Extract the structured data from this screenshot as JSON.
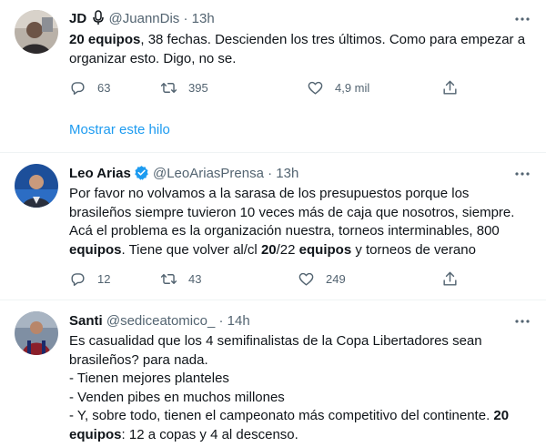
{
  "tweets": [
    {
      "name": "JD",
      "handle": "@JuannDis",
      "time": "13h",
      "text": [
        [
          {
            "b": "20 equipos"
          },
          {
            "t": ", 38 fechas. Descienden los tres últimos. Como para empezar a organizar esto. Digo, no se."
          }
        ]
      ],
      "replies": "63",
      "retweets": "395",
      "likes": "4,9 mil",
      "show_thread": "Mostrar este hilo"
    },
    {
      "name": "Leo Arias",
      "handle": "@LeoAriasPrensa",
      "time": "13h",
      "verified": true,
      "text": [
        [
          {
            "t": "Por favor no volvamos a la sarasa de los presupuestos porque los brasileños siempre tuvieron 10 veces más de caja que nosotros, siempre."
          }
        ],
        [
          {
            "t": "Acá el problema es la organización nuestra, torneos interminables, 800 "
          },
          {
            "b": "equipos"
          },
          {
            "t": ". Tiene que volver al/cl "
          },
          {
            "b": "20"
          },
          {
            "t": "/22 "
          },
          {
            "b": "equipos"
          },
          {
            "t": " y torneos de verano"
          }
        ]
      ],
      "replies": "12",
      "retweets": "43",
      "likes": "249"
    },
    {
      "name": "Santi",
      "handle": "@sediceatomico_",
      "time": "14h",
      "text": [
        [
          {
            "t": "Es casualidad que los 4 semifinalistas de la Copa Libertadores sean brasileños? para nada."
          }
        ],
        [
          {
            "t": "- Tienen mejores planteles"
          }
        ],
        [
          {
            "t": "- Venden pibes en muchos millones"
          }
        ],
        [
          {
            "t": "- Y, sobre todo, tienen el campeonato más competitivo del continente. "
          },
          {
            "b": "20 equipos"
          },
          {
            "t": ": 12 a copas y 4 al descenso."
          }
        ]
      ]
    }
  ],
  "icons": {
    "reply": "reply-icon",
    "retweet": "retweet-icon",
    "like": "heart-icon",
    "share": "share-icon",
    "more": "more-icon",
    "verified": "verified-badge-icon",
    "mic": "microphone-icon"
  },
  "colors": {
    "accent": "#1d9bf0",
    "secondary_text": "#536471",
    "divider": "#eff3f4"
  }
}
